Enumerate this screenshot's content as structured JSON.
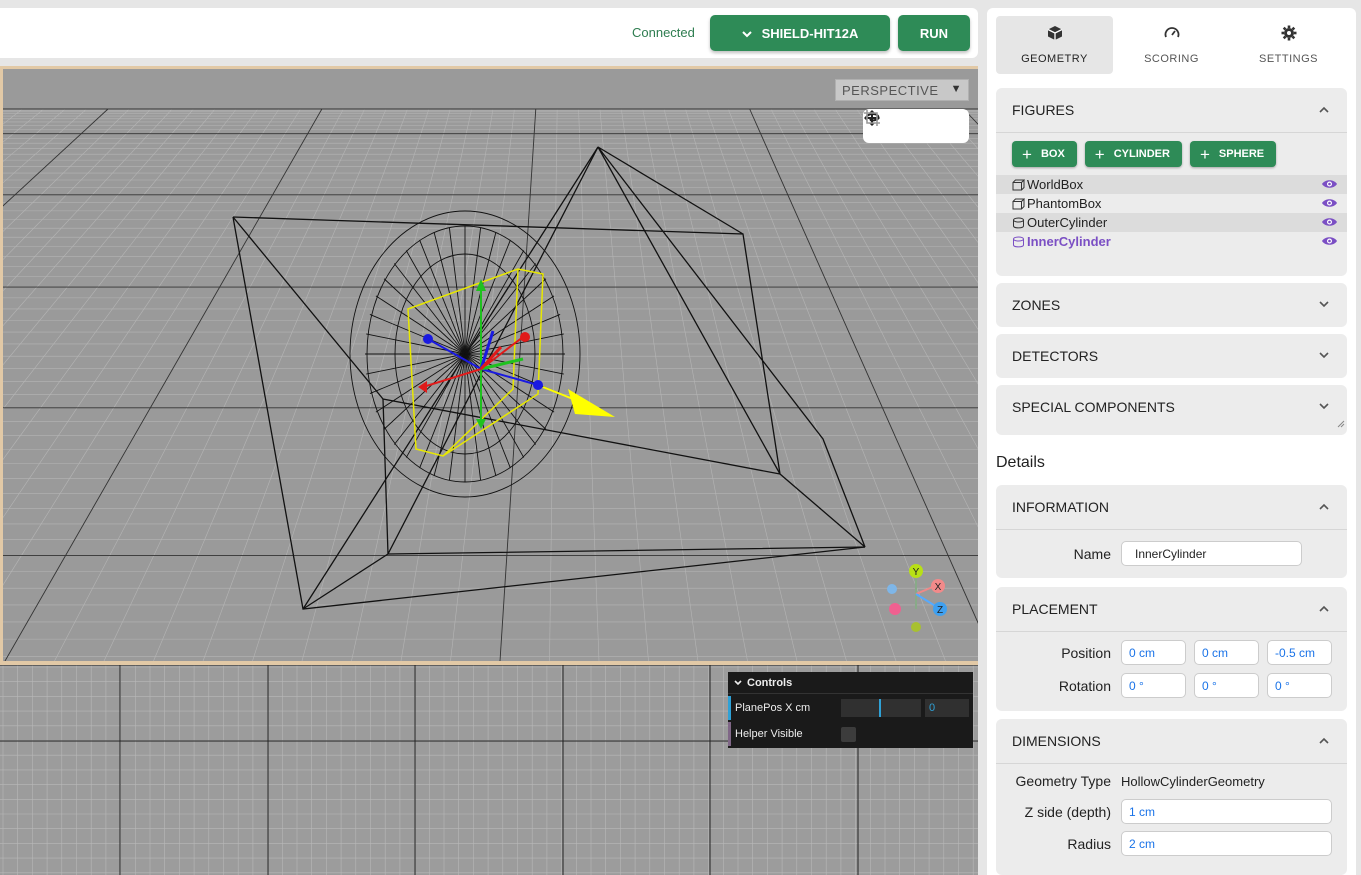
{
  "topbar": {
    "status": "Connected",
    "simulator_label": "SHIELD-HIT12A",
    "run_label": "RUN"
  },
  "viewport": {
    "camera_mode": "PERSPECTIVE",
    "tools": [
      "move-icon",
      "rotate-icon",
      "scale-icon"
    ],
    "axis_labels": {
      "x": "X",
      "y": "Y",
      "z": "Z"
    }
  },
  "controls": {
    "title": "Controls",
    "plane_pos_label": "PlanePos X cm",
    "plane_pos_value": "0",
    "helper_visible_label": "Helper Visible",
    "helper_visible": false
  },
  "tabs": [
    {
      "label": "GEOMETRY",
      "icon": "cube-icon",
      "active": true
    },
    {
      "label": "SCORING",
      "icon": "gauge-icon",
      "active": false
    },
    {
      "label": "SETTINGS",
      "icon": "gear-icon",
      "active": false
    }
  ],
  "figures": {
    "title": "FIGURES",
    "buttons": [
      "BOX",
      "CYLINDER",
      "SPHERE"
    ],
    "items": [
      {
        "name": "WorldBox",
        "type": "box",
        "selected": false
      },
      {
        "name": "PhantomBox",
        "type": "box",
        "selected": false
      },
      {
        "name": "OuterCylinder",
        "type": "cylinder",
        "selected": false
      },
      {
        "name": "InnerCylinder",
        "type": "cylinder",
        "selected": true
      }
    ]
  },
  "sections": {
    "zones": "ZONES",
    "detectors": "DETECTORS",
    "special": "SPECIAL COMPONENTS"
  },
  "details": {
    "title": "Details",
    "information": {
      "title": "INFORMATION",
      "name_label": "Name",
      "name_value": "InnerCylinder"
    },
    "placement": {
      "title": "PLACEMENT",
      "position_label": "Position",
      "position": [
        "0 cm",
        "0 cm",
        "-0.5 cm"
      ],
      "rotation_label": "Rotation",
      "rotation": [
        "0 °",
        "0 °",
        "0 °"
      ]
    },
    "dimensions": {
      "title": "DIMENSIONS",
      "geometry_type_label": "Geometry Type",
      "geometry_type_value": "HollowCylinderGeometry",
      "depth_label": "Z side (depth)",
      "depth_value": "1 cm",
      "radius_label": "Radius",
      "radius_value": "2 cm"
    }
  },
  "colors": {
    "accent_green": "#2e8b57",
    "selected_purple": "#7b4fc4",
    "gizmo_yellow": "#ffff00"
  }
}
